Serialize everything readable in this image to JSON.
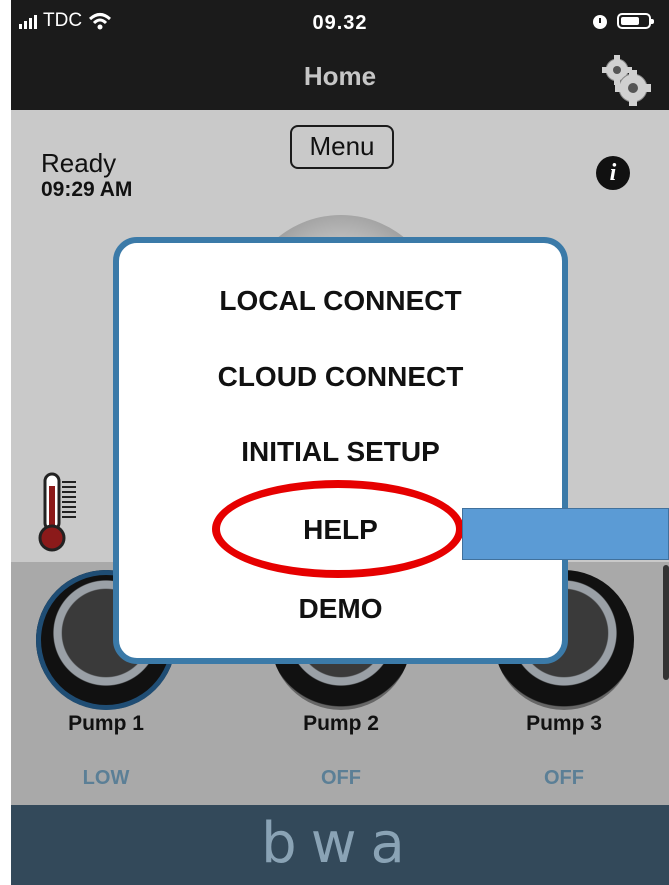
{
  "status_bar": {
    "carrier": "TDC",
    "time": "09.32"
  },
  "navbar": {
    "title": "Home"
  },
  "home": {
    "menu_label": "Menu",
    "status": "Ready",
    "status_time": "09:29 AM",
    "info_label": "i"
  },
  "pumps": [
    {
      "label": "Pump 1",
      "status": "LOW"
    },
    {
      "label": "Pump 2",
      "status": "OFF"
    },
    {
      "label": "Pump 3",
      "status": "OFF"
    }
  ],
  "popup": {
    "items": [
      "LOCAL CONNECT",
      "CLOUD CONNECT",
      "INITIAL SETUP",
      "HELP",
      "DEMO"
    ]
  },
  "footer": {
    "logo_text": "bwa"
  },
  "colors": {
    "popup_border": "#3b7aa8",
    "highlight_circle": "#e60000",
    "arrow_fill": "#5b9bd5",
    "footer_bg": "#33495a",
    "pump_status": "#5b7f96"
  }
}
